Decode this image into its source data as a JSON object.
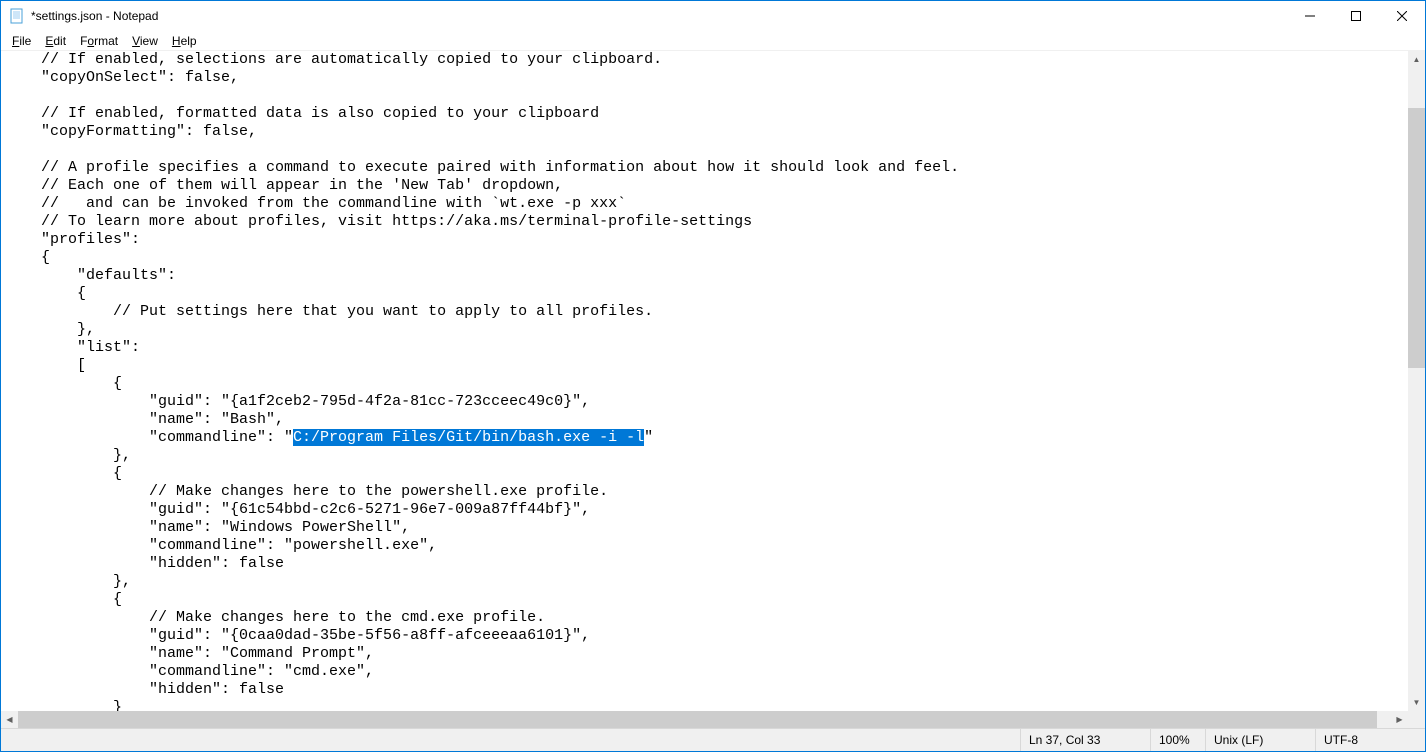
{
  "window": {
    "title": "*settings.json - Notepad"
  },
  "menu": {
    "file": "File",
    "edit": "Edit",
    "format": "Format",
    "view": "View",
    "help": "Help"
  },
  "status": {
    "position": "Ln 37, Col 33",
    "zoom": "100%",
    "line_ending": "Unix (LF)",
    "encoding": "UTF-8"
  },
  "editor": {
    "lines": [
      "    // If enabled, selections are automatically copied to your clipboard.",
      "    \"copyOnSelect\": false,",
      "",
      "    // If enabled, formatted data is also copied to your clipboard",
      "    \"copyFormatting\": false,",
      "",
      "    // A profile specifies a command to execute paired with information about how it should look and feel.",
      "    // Each one of them will appear in the 'New Tab' dropdown,",
      "    //   and can be invoked from the commandline with `wt.exe -p xxx`",
      "    // To learn more about profiles, visit https://aka.ms/terminal-profile-settings",
      "    \"profiles\":",
      "    {",
      "        \"defaults\":",
      "        {",
      "            // Put settings here that you want to apply to all profiles.",
      "        },",
      "        \"list\":",
      "        [",
      "            {",
      "                \"guid\": \"{a1f2ceb2-795d-4f2a-81cc-723cceec49c0}\",",
      "                \"name\": \"Bash\",",
      "",
      "            },",
      "            {",
      "                // Make changes here to the powershell.exe profile.",
      "                \"guid\": \"{61c54bbd-c2c6-5271-96e7-009a87ff44bf}\",",
      "                \"name\": \"Windows PowerShell\",",
      "                \"commandline\": \"powershell.exe\",",
      "                \"hidden\": false",
      "            },",
      "            {",
      "                // Make changes here to the cmd.exe profile.",
      "                \"guid\": \"{0caa0dad-35be-5f56-a8ff-afceeeaa6101}\",",
      "                \"name\": \"Command Prompt\",",
      "                \"commandline\": \"cmd.exe\",",
      "                \"hidden\": false",
      "            }"
    ],
    "selection_line": {
      "prefix": "                \"commandline\": \"",
      "selected": "C:/Program Files/Git/bin/bash.exe -i -l",
      "suffix": "\""
    }
  }
}
